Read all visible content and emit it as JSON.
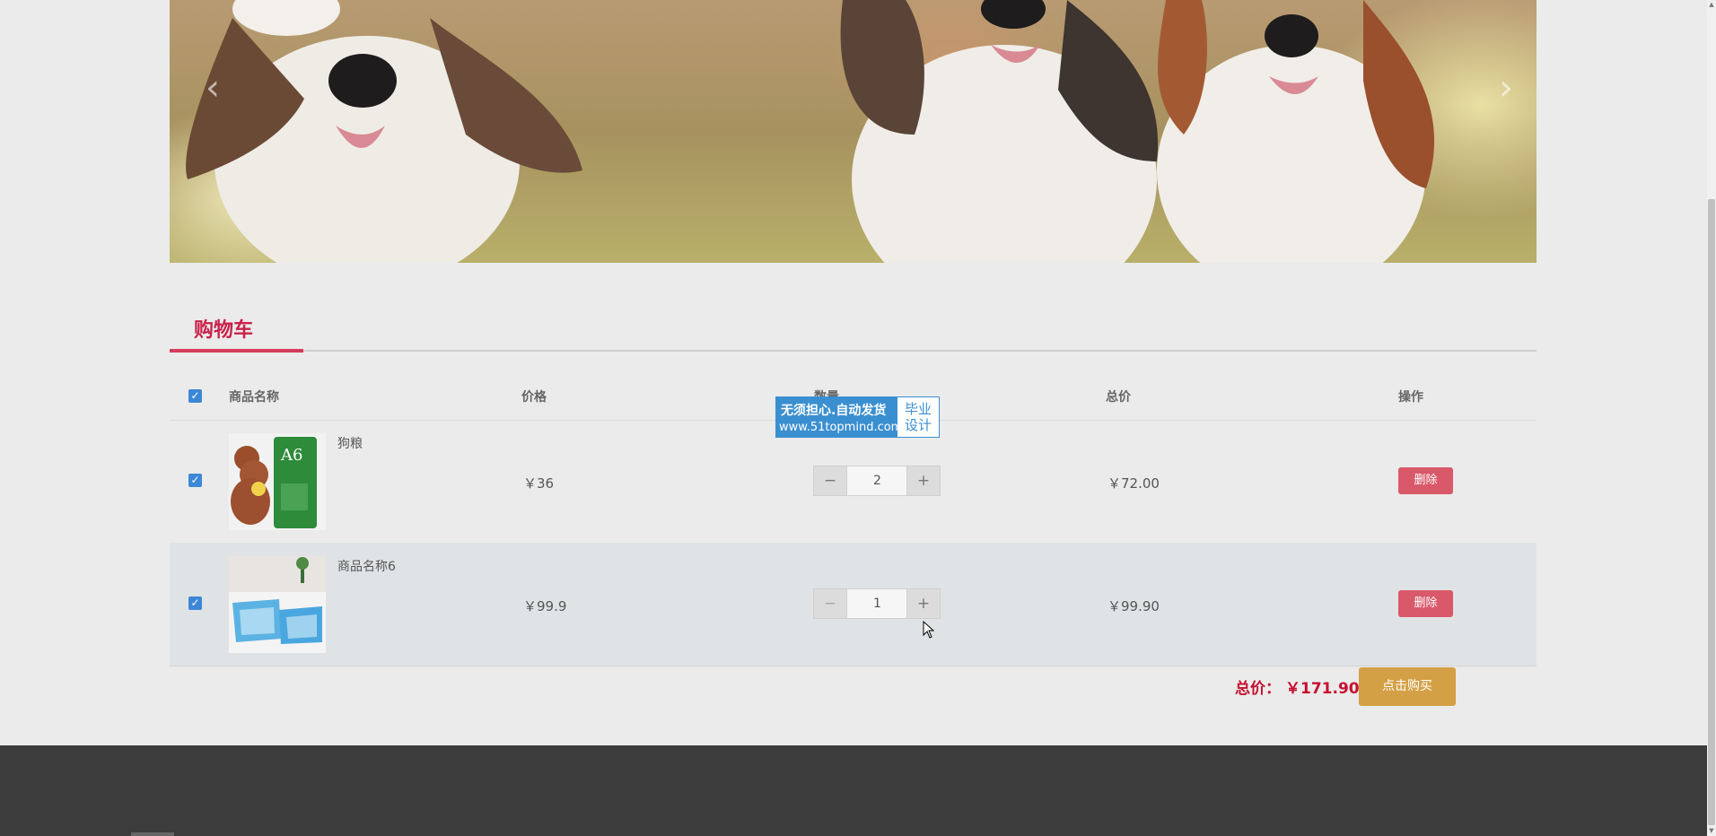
{
  "banner": {
    "prev_icon": "chevron-left-icon",
    "next_icon": "chevron-right-icon",
    "prev_glyph": "‹",
    "next_glyph": "›"
  },
  "cart": {
    "title": "购物车",
    "columns": {
      "name": "商品名称",
      "price": "价格",
      "quantity": "数量",
      "total": "总价",
      "action": "操作"
    },
    "items": [
      {
        "name": "狗粮",
        "price": "￥36",
        "quantity": "2",
        "subtotal": "￥72.00",
        "delete_label": "删除",
        "checked": true,
        "image_icon": "dog-food-bag-image"
      },
      {
        "name": "商品名称6",
        "price": "￥99.9",
        "quantity": "1",
        "subtotal": "￥99.90",
        "delete_label": "删除",
        "checked": true,
        "image_icon": "pet-tray-image"
      }
    ],
    "minus_glyph": "−",
    "plus_glyph": "+",
    "check_glyph": "✓",
    "total_label": "总价：",
    "total_amount": "￥171.90",
    "buy_label": "点击购买"
  },
  "watermark": {
    "line1": "无须担心.自动发货",
    "line2": "www.51topmind.com",
    "box": "毕业\n设计"
  },
  "colors": {
    "accent": "#c9224b",
    "delete": "#d9596a",
    "buy": "#d4a046",
    "checkbox": "#3d88d6",
    "footer": "#3c3c3c"
  }
}
